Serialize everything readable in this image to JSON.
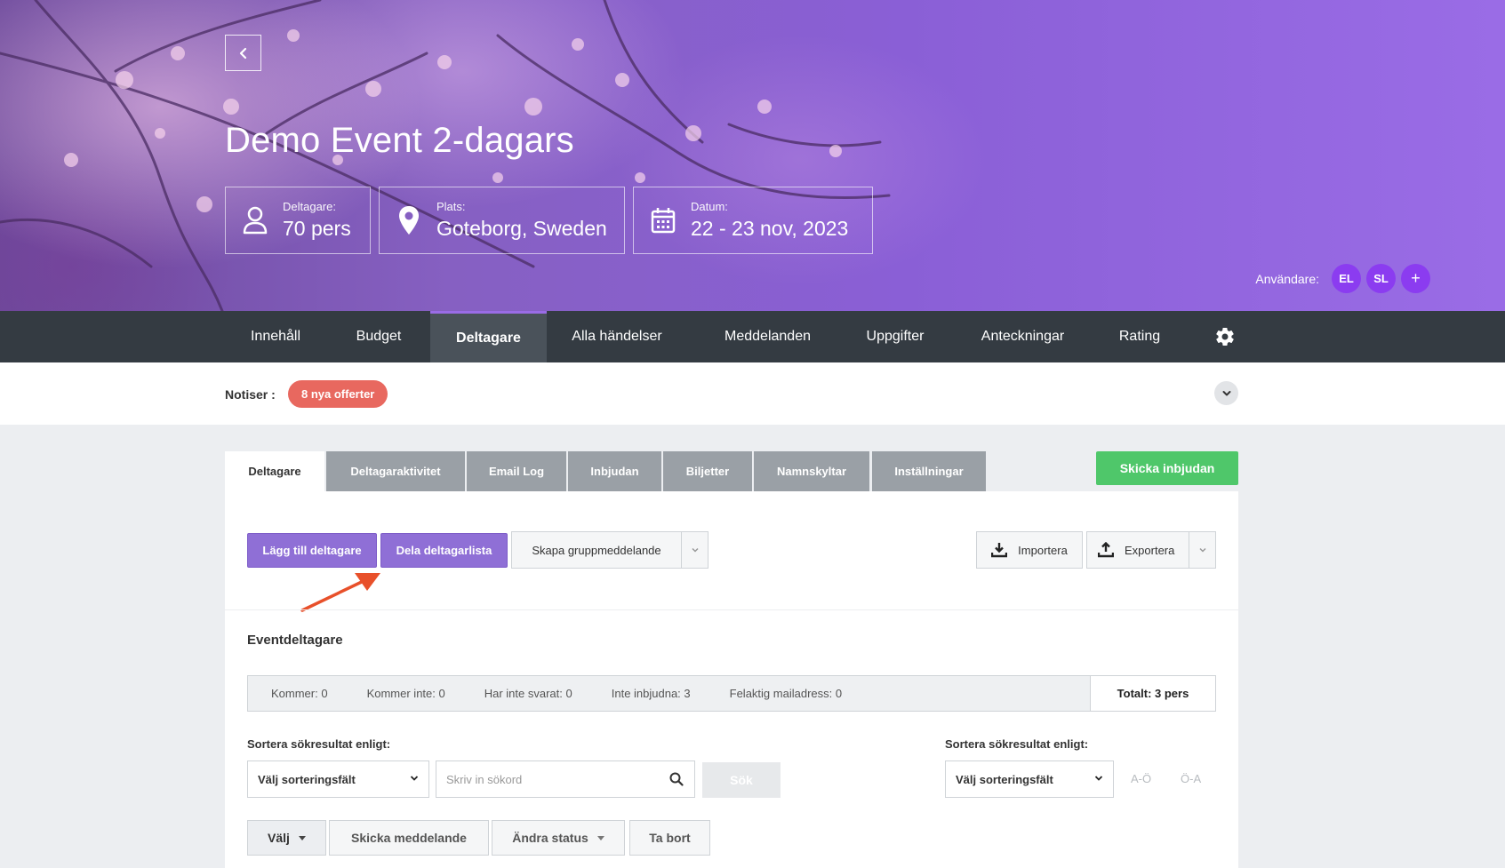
{
  "event": {
    "title": "Demo Event 2-dagars",
    "participants_label": "Deltagare:",
    "participants_value": "70 pers",
    "location_label": "Plats:",
    "location_value": "Goteborg, Sweden",
    "date_label": "Datum:",
    "date_value": "22 - 23 nov, 2023"
  },
  "users": {
    "label": "Användare:",
    "avatars": [
      "EL",
      "SL"
    ],
    "add": "+"
  },
  "nav": {
    "items": [
      "Innehåll",
      "Budget",
      "Deltagare",
      "Alla händelser",
      "Meddelanden",
      "Uppgifter",
      "Anteckningar",
      "Rating"
    ],
    "active": "Deltagare"
  },
  "notis": {
    "label": "Notiser :",
    "badge": "8 nya offerter"
  },
  "tabs": {
    "items": [
      "Deltagare",
      "Deltagaraktivitet",
      "Email Log",
      "Inbjudan",
      "Biljetter",
      "Namnskyltar",
      "Inställningar"
    ],
    "send_invite": "Skicka inbjudan"
  },
  "toolbar": {
    "add_participant": "Lägg till deltagare",
    "share_list": "Dela deltagarlista",
    "group_message": "Skapa gruppmeddelande",
    "import": "Importera",
    "export": "Exportera"
  },
  "section": {
    "title": "Eventdeltagare"
  },
  "stats": {
    "coming": "Kommer: 0",
    "not_coming": "Kommer inte: 0",
    "not_answered": "Har inte svarat: 0",
    "not_invited": "Inte inbjudna: 3",
    "wrong_email": "Felaktig mailadress: 0",
    "total": "Totalt: 3 pers"
  },
  "sort": {
    "label_left": "Sortera sökresultat enligt:",
    "label_right": "Sortera sökresultat enligt:",
    "select_left": "Välj sorteringsfält",
    "select_right": "Välj sorteringsfält",
    "search_placeholder": "Skriv in sökord",
    "search_button": "Sök",
    "az": "A-Ö",
    "za": "Ö-A"
  },
  "actions": {
    "choose": "Välj",
    "send_message": "Skicka meddelande",
    "change_status": "Ändra status",
    "delete": "Ta bort"
  },
  "colors": {
    "purple": "#8f6fd6",
    "green": "#4fc76a",
    "red_badge": "#e8685f",
    "nav_bg": "#343b42",
    "avatar": "#8b3cf0",
    "arrow": "#e8502a"
  }
}
